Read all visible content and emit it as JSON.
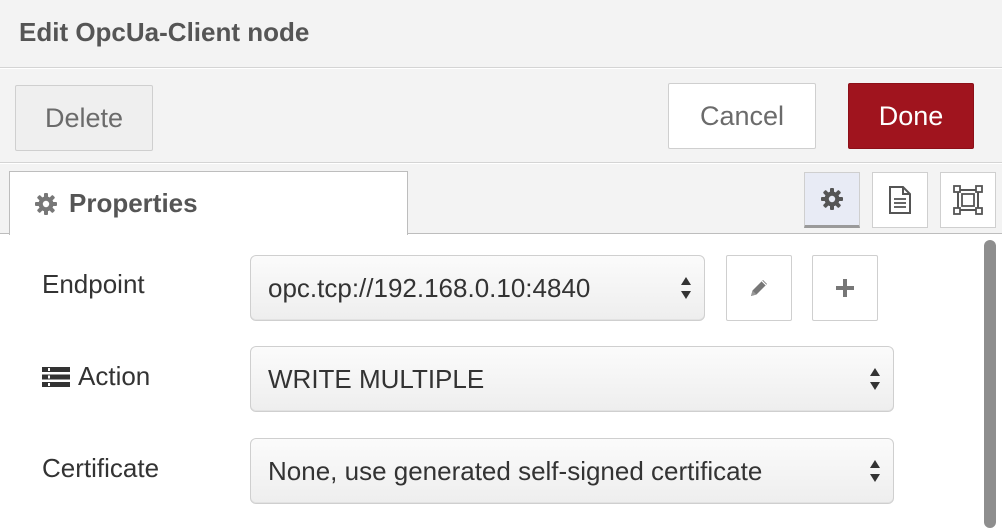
{
  "dialog": {
    "title": "Edit OpcUa-Client node"
  },
  "toolbar": {
    "delete_label": "Delete",
    "cancel_label": "Cancel",
    "done_label": "Done",
    "done_color": "#a0141e"
  },
  "tabs": {
    "properties_label": "Properties",
    "side_tabs": [
      {
        "icon": "gear-icon",
        "active": true
      },
      {
        "icon": "document-icon",
        "active": false
      },
      {
        "icon": "frame-icon",
        "active": false
      }
    ]
  },
  "form": {
    "endpoint": {
      "label": "Endpoint",
      "value": "opc.tcp://192.168.0.10:4840",
      "edit_icon": "pencil-icon",
      "add_icon": "plus-icon"
    },
    "action": {
      "label": "Action",
      "label_icon": "list-icon",
      "value": "WRITE MULTIPLE"
    },
    "certificate": {
      "label": "Certificate",
      "value": "None, use generated self-signed certificate"
    }
  }
}
